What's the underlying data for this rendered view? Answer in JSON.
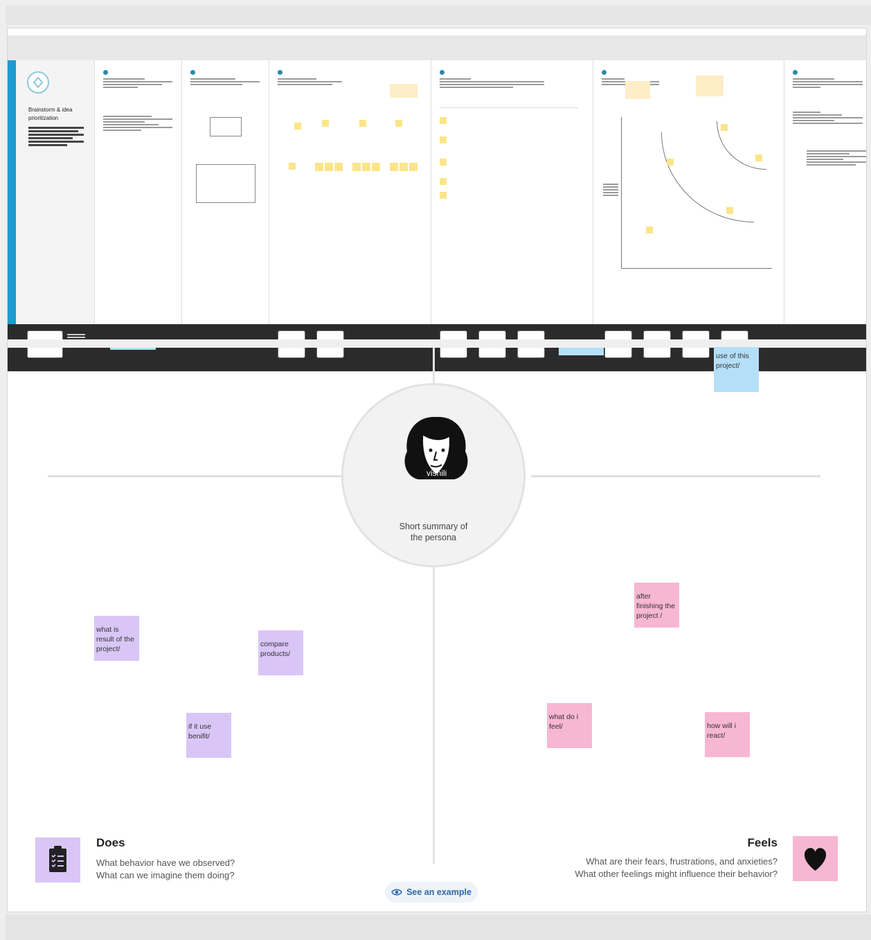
{
  "template_strip": {
    "first_panel_title": "Brainstorm & idea prioritization"
  },
  "empathy_map": {
    "persona": {
      "name": "vishili",
      "summary_line1": "Short summary of",
      "summary_line2": "the persona"
    },
    "stickies": [
      {
        "text": "what is result of the project/",
        "color": "#d9c6f7"
      },
      {
        "text": "compare products/",
        "color": "#d9c6f7"
      },
      {
        "text": "if it use benifit/",
        "color": "#d9c6f7"
      },
      {
        "text": "after finishing the project /",
        "color": "#f7b7d3"
      },
      {
        "text": "what do i feel/",
        "color": "#f7b7d3"
      },
      {
        "text": "how will i react/",
        "color": "#f7b7d3"
      },
      {
        "text": "use of this project/",
        "color": "#b5dff7"
      }
    ],
    "does": {
      "title": "Does",
      "q1": "What behavior have we observed?",
      "q2": "What can we imagine them doing?",
      "icon": "clipboard-icon"
    },
    "feels": {
      "title": "Feels",
      "q1": "What are their fears, frustrations, and anxieties?",
      "q2": "What other feelings might influence their behavior?",
      "icon": "heart-icon"
    },
    "see_example": "See an example"
  }
}
